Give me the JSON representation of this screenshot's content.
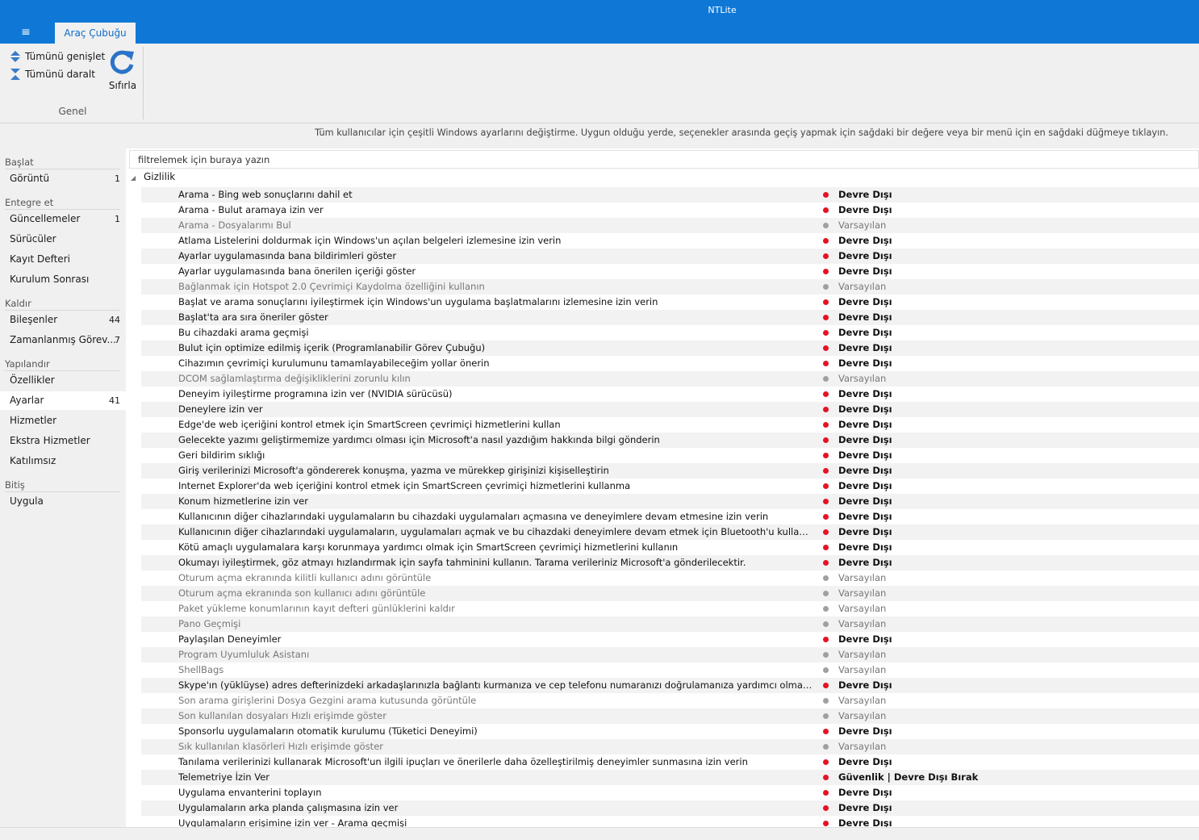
{
  "window": {
    "title": "NTLite"
  },
  "menu": {
    "icon": "hamburger-icon",
    "glyph": "≡"
  },
  "tabs": [
    {
      "label": "Araç Çubuğu"
    }
  ],
  "ribbon": {
    "expand_all": "Tümünü genişlet",
    "collapse_all": "Tümünü daralt",
    "reset": "Sıfırla",
    "group_label": "Genel"
  },
  "description": "Tüm kullanıcılar için çeşitli Windows ayarlarını değiştirme. Uygun olduğu yerde, seçenekler arasında geçiş yapmak için sağdaki bir değere veya bir menü için en sağdaki düğmeye tıklayın.",
  "sidebar": {
    "sections": [
      {
        "header": "Başlat",
        "items": [
          {
            "label": "Görüntü",
            "count": "1"
          }
        ]
      },
      {
        "header": "Entegre et",
        "items": [
          {
            "label": "Güncellemeler",
            "count": "1"
          },
          {
            "label": "Sürücüler",
            "count": ""
          },
          {
            "label": "Kayıt Defteri",
            "count": ""
          },
          {
            "label": "Kurulum Sonrası",
            "count": ""
          }
        ]
      },
      {
        "header": "Kaldır",
        "items": [
          {
            "label": "Bileşenler",
            "count": "44"
          },
          {
            "label": "Zamanlanmış Görev...",
            "count": "7"
          }
        ]
      },
      {
        "header": "Yapılandır",
        "items": [
          {
            "label": "Özellikler",
            "count": ""
          },
          {
            "label": "Ayarlar",
            "count": "41",
            "active": true
          },
          {
            "label": "Hizmetler",
            "count": ""
          },
          {
            "label": "Ekstra Hizmetler",
            "count": ""
          },
          {
            "label": "Katılımsız",
            "count": ""
          }
        ]
      },
      {
        "header": "Bitiş",
        "items": [
          {
            "label": "Uygula",
            "count": ""
          }
        ]
      }
    ]
  },
  "filter": {
    "placeholder": "filtrelemek için buraya yazın"
  },
  "settings": {
    "group": "Gizlilik",
    "colors": {
      "disabled": "#e81123",
      "default": "#a0a0a0"
    },
    "rows": [
      {
        "name": "Arama - Bing web sonuçlarını dahil et",
        "value": "Devre Dışı",
        "state": "disabled"
      },
      {
        "name": "Arama - Bulut aramaya izin ver",
        "value": "Devre Dışı",
        "state": "disabled"
      },
      {
        "name": "Arama - Dosyalarımı Bul",
        "value": "Varsayılan",
        "state": "default"
      },
      {
        "name": "Atlama Listelerini doldurmak için Windows'un açılan belgeleri izlemesine izin verin",
        "value": "Devre Dışı",
        "state": "disabled"
      },
      {
        "name": "Ayarlar uygulamasında bana bildirimleri göster",
        "value": "Devre Dışı",
        "state": "disabled"
      },
      {
        "name": "Ayarlar uygulamasında bana önerilen içeriği göster",
        "value": "Devre Dışı",
        "state": "disabled"
      },
      {
        "name": "Bağlanmak için Hotspot 2.0 Çevrimiçi Kaydolma özelliğini kullanın",
        "value": "Varsayılan",
        "state": "default"
      },
      {
        "name": "Başlat ve arama sonuçlarını iyileştirmek için Windows'un uygulama başlatmalarını izlemesine izin verin",
        "value": "Devre Dışı",
        "state": "disabled"
      },
      {
        "name": "Başlat'ta ara sıra öneriler göster",
        "value": "Devre Dışı",
        "state": "disabled"
      },
      {
        "name": "Bu cihazdaki arama geçmişi",
        "value": "Devre Dışı",
        "state": "disabled"
      },
      {
        "name": "Bulut için optimize edilmiş içerik (Programlanabilir Görev Çubuğu)",
        "value": "Devre Dışı",
        "state": "disabled"
      },
      {
        "name": "Cihazımın çevrimiçi kurulumunu tamamlayabileceğim yollar önerin",
        "value": "Devre Dışı",
        "state": "disabled"
      },
      {
        "name": "DCOM sağlamlaştırma değişikliklerini zorunlu kılın",
        "value": "Varsayılan",
        "state": "default"
      },
      {
        "name": "Deneyim iyileştirme programına izin ver (NVIDIA sürücüsü)",
        "value": "Devre Dışı",
        "state": "disabled"
      },
      {
        "name": "Deneylere izin ver",
        "value": "Devre Dışı",
        "state": "disabled"
      },
      {
        "name": "Edge'de web içeriğini kontrol etmek için SmartScreen çevrimiçi hizmetlerini kullan",
        "value": "Devre Dışı",
        "state": "disabled"
      },
      {
        "name": "Gelecekte yazımı geliştirmemize yardımcı olması için Microsoft'a nasıl yazdığım hakkında bilgi gönderin",
        "value": "Devre Dışı",
        "state": "disabled"
      },
      {
        "name": "Geri bildirim sıklığı",
        "value": "Devre Dışı",
        "state": "disabled"
      },
      {
        "name": "Giriş verilerinizi Microsoft'a göndererek konuşma, yazma ve mürekkep girişinizi kişiselleştirin",
        "value": "Devre Dışı",
        "state": "disabled"
      },
      {
        "name": "Internet Explorer'da web içeriğini kontrol etmek için SmartScreen çevrimiçi hizmetlerini kullanma",
        "value": "Devre Dışı",
        "state": "disabled"
      },
      {
        "name": "Konum hizmetlerine izin ver",
        "value": "Devre Dışı",
        "state": "disabled"
      },
      {
        "name": "Kullanıcının diğer cihazlarındaki uygulamaların bu cihazdaki uygulamaları açmasına ve deneyimlere devam etmesine izin verin",
        "value": "Devre Dışı",
        "state": "disabled"
      },
      {
        "name": "Kullanıcının diğer cihazlarındaki uygulamaların, uygulamaları açmak ve bu cihazdaki deneyimlere devam etmek için Bluetooth'u kullanmasına izin v...",
        "value": "Devre Dışı",
        "state": "disabled"
      },
      {
        "name": "Kötü amaçlı uygulamalara karşı korunmaya yardımcı olmak için SmartScreen çevrimiçi hizmetlerini kullanın",
        "value": "Devre Dışı",
        "state": "disabled"
      },
      {
        "name": "Okumayı iyileştirmek, göz atmayı hızlandırmak için sayfa tahminini kullanın. Tarama verileriniz Microsoft'a gönderilecektir.",
        "value": "Devre Dışı",
        "state": "disabled"
      },
      {
        "name": "Oturum açma ekranında kilitli kullanıcı adını görüntüle",
        "value": "Varsayılan",
        "state": "default"
      },
      {
        "name": "Oturum açma ekranında son kullanıcı adını görüntüle",
        "value": "Varsayılan",
        "state": "default"
      },
      {
        "name": "Paket yükleme konumlarının kayıt defteri günlüklerini kaldır",
        "value": "Varsayılan",
        "state": "default"
      },
      {
        "name": "Pano Geçmişi",
        "value": "Varsayılan",
        "state": "default"
      },
      {
        "name": "Paylaşılan Deneyimler",
        "value": "Devre Dışı",
        "state": "disabled"
      },
      {
        "name": "Program Uyumluluk Asistanı",
        "value": "Varsayılan",
        "state": "default"
      },
      {
        "name": "ShellBags",
        "value": "Varsayılan",
        "state": "default"
      },
      {
        "name": "Skype'ın (yüklüyse) adres defterinizdeki arkadaşlarınızla bağlantı kurmanıza ve cep telefonu numaranızı doğrulamanıza yardımcı olmasına izin verin",
        "value": "Devre Dışı",
        "state": "disabled"
      },
      {
        "name": "Son arama girişlerini Dosya Gezgini arama kutusunda görüntüle",
        "value": "Varsayılan",
        "state": "default"
      },
      {
        "name": "Son kullanılan dosyaları Hızlı erişimde göster",
        "value": "Varsayılan",
        "state": "default"
      },
      {
        "name": "Sponsorlu uygulamaların otomatik kurulumu (Tüketici Deneyimi)",
        "value": "Devre Dışı",
        "state": "disabled"
      },
      {
        "name": "Sık kullanılan klasörleri Hızlı erişimde göster",
        "value": "Varsayılan",
        "state": "default"
      },
      {
        "name": "Tanılama verilerinizi kullanarak Microsoft'un ilgili ipuçları ve önerilerle daha özelleştirilmiş deneyimler sunmasına izin verin",
        "value": "Devre Dışı",
        "state": "disabled"
      },
      {
        "name": "Telemetriye İzin Ver",
        "value": "Güvenlik | Devre Dışı Bırak",
        "state": "disabled"
      },
      {
        "name": "Uygulama envanterini toplayın",
        "value": "Devre Dışı",
        "state": "disabled"
      },
      {
        "name": "Uygulamaların arka planda çalışmasına izin ver",
        "value": "Devre Dışı",
        "state": "disabled"
      },
      {
        "name": "Uygulamaların erişimine izin ver - Arama geçmişi",
        "value": "Devre Dışı",
        "state": "disabled"
      }
    ]
  }
}
